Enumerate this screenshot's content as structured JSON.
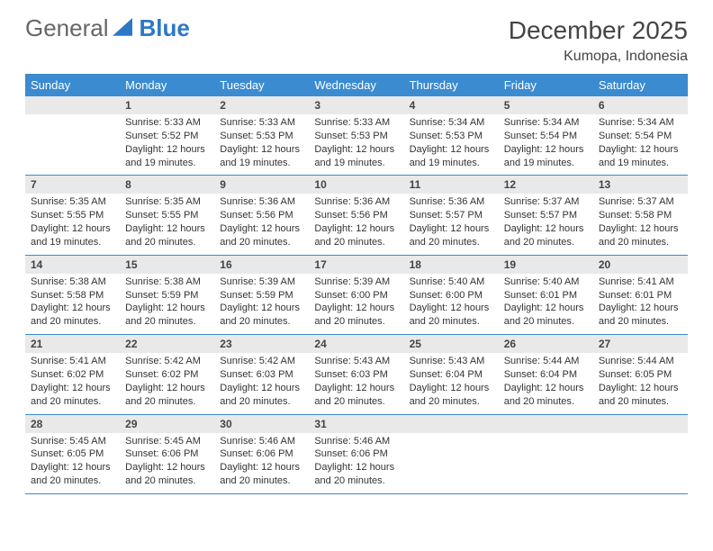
{
  "logo": {
    "word1": "General",
    "word2": "Blue"
  },
  "header": {
    "title": "December 2025",
    "location": "Kumopa, Indonesia"
  },
  "weekdays": [
    "Sunday",
    "Monday",
    "Tuesday",
    "Wednesday",
    "Thursday",
    "Friday",
    "Saturday"
  ],
  "weeks": [
    [
      {
        "num": "",
        "lines": [
          "",
          "",
          "",
          ""
        ]
      },
      {
        "num": "1",
        "lines": [
          "Sunrise: 5:33 AM",
          "Sunset: 5:52 PM",
          "Daylight: 12 hours",
          "and 19 minutes."
        ]
      },
      {
        "num": "2",
        "lines": [
          "Sunrise: 5:33 AM",
          "Sunset: 5:53 PM",
          "Daylight: 12 hours",
          "and 19 minutes."
        ]
      },
      {
        "num": "3",
        "lines": [
          "Sunrise: 5:33 AM",
          "Sunset: 5:53 PM",
          "Daylight: 12 hours",
          "and 19 minutes."
        ]
      },
      {
        "num": "4",
        "lines": [
          "Sunrise: 5:34 AM",
          "Sunset: 5:53 PM",
          "Daylight: 12 hours",
          "and 19 minutes."
        ]
      },
      {
        "num": "5",
        "lines": [
          "Sunrise: 5:34 AM",
          "Sunset: 5:54 PM",
          "Daylight: 12 hours",
          "and 19 minutes."
        ]
      },
      {
        "num": "6",
        "lines": [
          "Sunrise: 5:34 AM",
          "Sunset: 5:54 PM",
          "Daylight: 12 hours",
          "and 19 minutes."
        ]
      }
    ],
    [
      {
        "num": "7",
        "lines": [
          "Sunrise: 5:35 AM",
          "Sunset: 5:55 PM",
          "Daylight: 12 hours",
          "and 19 minutes."
        ]
      },
      {
        "num": "8",
        "lines": [
          "Sunrise: 5:35 AM",
          "Sunset: 5:55 PM",
          "Daylight: 12 hours",
          "and 20 minutes."
        ]
      },
      {
        "num": "9",
        "lines": [
          "Sunrise: 5:36 AM",
          "Sunset: 5:56 PM",
          "Daylight: 12 hours",
          "and 20 minutes."
        ]
      },
      {
        "num": "10",
        "lines": [
          "Sunrise: 5:36 AM",
          "Sunset: 5:56 PM",
          "Daylight: 12 hours",
          "and 20 minutes."
        ]
      },
      {
        "num": "11",
        "lines": [
          "Sunrise: 5:36 AM",
          "Sunset: 5:57 PM",
          "Daylight: 12 hours",
          "and 20 minutes."
        ]
      },
      {
        "num": "12",
        "lines": [
          "Sunrise: 5:37 AM",
          "Sunset: 5:57 PM",
          "Daylight: 12 hours",
          "and 20 minutes."
        ]
      },
      {
        "num": "13",
        "lines": [
          "Sunrise: 5:37 AM",
          "Sunset: 5:58 PM",
          "Daylight: 12 hours",
          "and 20 minutes."
        ]
      }
    ],
    [
      {
        "num": "14",
        "lines": [
          "Sunrise: 5:38 AM",
          "Sunset: 5:58 PM",
          "Daylight: 12 hours",
          "and 20 minutes."
        ]
      },
      {
        "num": "15",
        "lines": [
          "Sunrise: 5:38 AM",
          "Sunset: 5:59 PM",
          "Daylight: 12 hours",
          "and 20 minutes."
        ]
      },
      {
        "num": "16",
        "lines": [
          "Sunrise: 5:39 AM",
          "Sunset: 5:59 PM",
          "Daylight: 12 hours",
          "and 20 minutes."
        ]
      },
      {
        "num": "17",
        "lines": [
          "Sunrise: 5:39 AM",
          "Sunset: 6:00 PM",
          "Daylight: 12 hours",
          "and 20 minutes."
        ]
      },
      {
        "num": "18",
        "lines": [
          "Sunrise: 5:40 AM",
          "Sunset: 6:00 PM",
          "Daylight: 12 hours",
          "and 20 minutes."
        ]
      },
      {
        "num": "19",
        "lines": [
          "Sunrise: 5:40 AM",
          "Sunset: 6:01 PM",
          "Daylight: 12 hours",
          "and 20 minutes."
        ]
      },
      {
        "num": "20",
        "lines": [
          "Sunrise: 5:41 AM",
          "Sunset: 6:01 PM",
          "Daylight: 12 hours",
          "and 20 minutes."
        ]
      }
    ],
    [
      {
        "num": "21",
        "lines": [
          "Sunrise: 5:41 AM",
          "Sunset: 6:02 PM",
          "Daylight: 12 hours",
          "and 20 minutes."
        ]
      },
      {
        "num": "22",
        "lines": [
          "Sunrise: 5:42 AM",
          "Sunset: 6:02 PM",
          "Daylight: 12 hours",
          "and 20 minutes."
        ]
      },
      {
        "num": "23",
        "lines": [
          "Sunrise: 5:42 AM",
          "Sunset: 6:03 PM",
          "Daylight: 12 hours",
          "and 20 minutes."
        ]
      },
      {
        "num": "24",
        "lines": [
          "Sunrise: 5:43 AM",
          "Sunset: 6:03 PM",
          "Daylight: 12 hours",
          "and 20 minutes."
        ]
      },
      {
        "num": "25",
        "lines": [
          "Sunrise: 5:43 AM",
          "Sunset: 6:04 PM",
          "Daylight: 12 hours",
          "and 20 minutes."
        ]
      },
      {
        "num": "26",
        "lines": [
          "Sunrise: 5:44 AM",
          "Sunset: 6:04 PM",
          "Daylight: 12 hours",
          "and 20 minutes."
        ]
      },
      {
        "num": "27",
        "lines": [
          "Sunrise: 5:44 AM",
          "Sunset: 6:05 PM",
          "Daylight: 12 hours",
          "and 20 minutes."
        ]
      }
    ],
    [
      {
        "num": "28",
        "lines": [
          "Sunrise: 5:45 AM",
          "Sunset: 6:05 PM",
          "Daylight: 12 hours",
          "and 20 minutes."
        ]
      },
      {
        "num": "29",
        "lines": [
          "Sunrise: 5:45 AM",
          "Sunset: 6:06 PM",
          "Daylight: 12 hours",
          "and 20 minutes."
        ]
      },
      {
        "num": "30",
        "lines": [
          "Sunrise: 5:46 AM",
          "Sunset: 6:06 PM",
          "Daylight: 12 hours",
          "and 20 minutes."
        ]
      },
      {
        "num": "31",
        "lines": [
          "Sunrise: 5:46 AM",
          "Sunset: 6:06 PM",
          "Daylight: 12 hours",
          "and 20 minutes."
        ]
      },
      {
        "num": "",
        "lines": [
          "",
          "",
          "",
          ""
        ]
      },
      {
        "num": "",
        "lines": [
          "",
          "",
          "",
          ""
        ]
      },
      {
        "num": "",
        "lines": [
          "",
          "",
          "",
          ""
        ]
      }
    ]
  ],
  "chart_data": {
    "type": "table",
    "title": "December 2025 sunrise/sunset — Kumopa, Indonesia",
    "columns": [
      "date",
      "sunrise",
      "sunset",
      "daylight_hours",
      "daylight_minutes"
    ],
    "rows": [
      [
        "2025-12-01",
        "5:33 AM",
        "5:52 PM",
        12,
        19
      ],
      [
        "2025-12-02",
        "5:33 AM",
        "5:53 PM",
        12,
        19
      ],
      [
        "2025-12-03",
        "5:33 AM",
        "5:53 PM",
        12,
        19
      ],
      [
        "2025-12-04",
        "5:34 AM",
        "5:53 PM",
        12,
        19
      ],
      [
        "2025-12-05",
        "5:34 AM",
        "5:54 PM",
        12,
        19
      ],
      [
        "2025-12-06",
        "5:34 AM",
        "5:54 PM",
        12,
        19
      ],
      [
        "2025-12-07",
        "5:35 AM",
        "5:55 PM",
        12,
        19
      ],
      [
        "2025-12-08",
        "5:35 AM",
        "5:55 PM",
        12,
        20
      ],
      [
        "2025-12-09",
        "5:36 AM",
        "5:56 PM",
        12,
        20
      ],
      [
        "2025-12-10",
        "5:36 AM",
        "5:56 PM",
        12,
        20
      ],
      [
        "2025-12-11",
        "5:36 AM",
        "5:57 PM",
        12,
        20
      ],
      [
        "2025-12-12",
        "5:37 AM",
        "5:57 PM",
        12,
        20
      ],
      [
        "2025-12-13",
        "5:37 AM",
        "5:58 PM",
        12,
        20
      ],
      [
        "2025-12-14",
        "5:38 AM",
        "5:58 PM",
        12,
        20
      ],
      [
        "2025-12-15",
        "5:38 AM",
        "5:59 PM",
        12,
        20
      ],
      [
        "2025-12-16",
        "5:39 AM",
        "5:59 PM",
        12,
        20
      ],
      [
        "2025-12-17",
        "5:39 AM",
        "6:00 PM",
        12,
        20
      ],
      [
        "2025-12-18",
        "5:40 AM",
        "6:00 PM",
        12,
        20
      ],
      [
        "2025-12-19",
        "5:40 AM",
        "6:01 PM",
        12,
        20
      ],
      [
        "2025-12-20",
        "5:41 AM",
        "6:01 PM",
        12,
        20
      ],
      [
        "2025-12-21",
        "5:41 AM",
        "6:02 PM",
        12,
        20
      ],
      [
        "2025-12-22",
        "5:42 AM",
        "6:02 PM",
        12,
        20
      ],
      [
        "2025-12-23",
        "5:42 AM",
        "6:03 PM",
        12,
        20
      ],
      [
        "2025-12-24",
        "5:43 AM",
        "6:03 PM",
        12,
        20
      ],
      [
        "2025-12-25",
        "5:43 AM",
        "6:04 PM",
        12,
        20
      ],
      [
        "2025-12-26",
        "5:44 AM",
        "6:04 PM",
        12,
        20
      ],
      [
        "2025-12-27",
        "5:44 AM",
        "6:05 PM",
        12,
        20
      ],
      [
        "2025-12-28",
        "5:45 AM",
        "6:05 PM",
        12,
        20
      ],
      [
        "2025-12-29",
        "5:45 AM",
        "6:06 PM",
        12,
        20
      ],
      [
        "2025-12-30",
        "5:46 AM",
        "6:06 PM",
        12,
        20
      ],
      [
        "2025-12-31",
        "5:46 AM",
        "6:06 PM",
        12,
        20
      ]
    ]
  }
}
